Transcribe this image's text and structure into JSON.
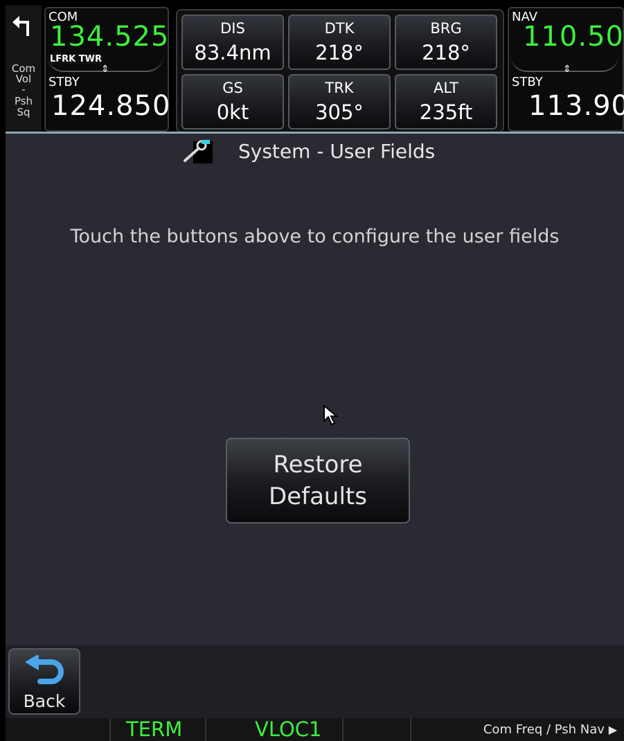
{
  "com_controls": {
    "line1": "Com",
    "line2": "Vol",
    "line3": "-",
    "line4": "Psh",
    "line5": "Sq"
  },
  "com": {
    "label": "COM",
    "active": "134.525",
    "id": "LFRK TWR",
    "stby_label": "STBY",
    "standby": "124.850"
  },
  "nav": {
    "label": "NAV",
    "active": "110.50",
    "stby_label": "STBY",
    "standby": "113.90"
  },
  "fields": {
    "dis": {
      "label": "DIS",
      "value": "83.4nm"
    },
    "dtk": {
      "label": "DTK",
      "value": "218°"
    },
    "brg": {
      "label": "BRG",
      "value": "218°"
    },
    "gs": {
      "label": "GS",
      "value": "0kt"
    },
    "trk": {
      "label": "TRK",
      "value": "305°"
    },
    "alt": {
      "label": "ALT",
      "value": "235ft"
    }
  },
  "page": {
    "title": "System - User Fields",
    "instruction": "Touch the buttons above to configure the user fields",
    "icon": "wrench-icon"
  },
  "restore": {
    "line1": "Restore",
    "line2": "Defaults"
  },
  "back": {
    "label": "Back"
  },
  "status": {
    "mode": "TERM",
    "nav_source": "VLOC1",
    "hint": "Com Freq / Psh Nav"
  },
  "colors": {
    "active_green": "#3cf03c",
    "background": "#2a2a33",
    "topbar": "#000000"
  }
}
